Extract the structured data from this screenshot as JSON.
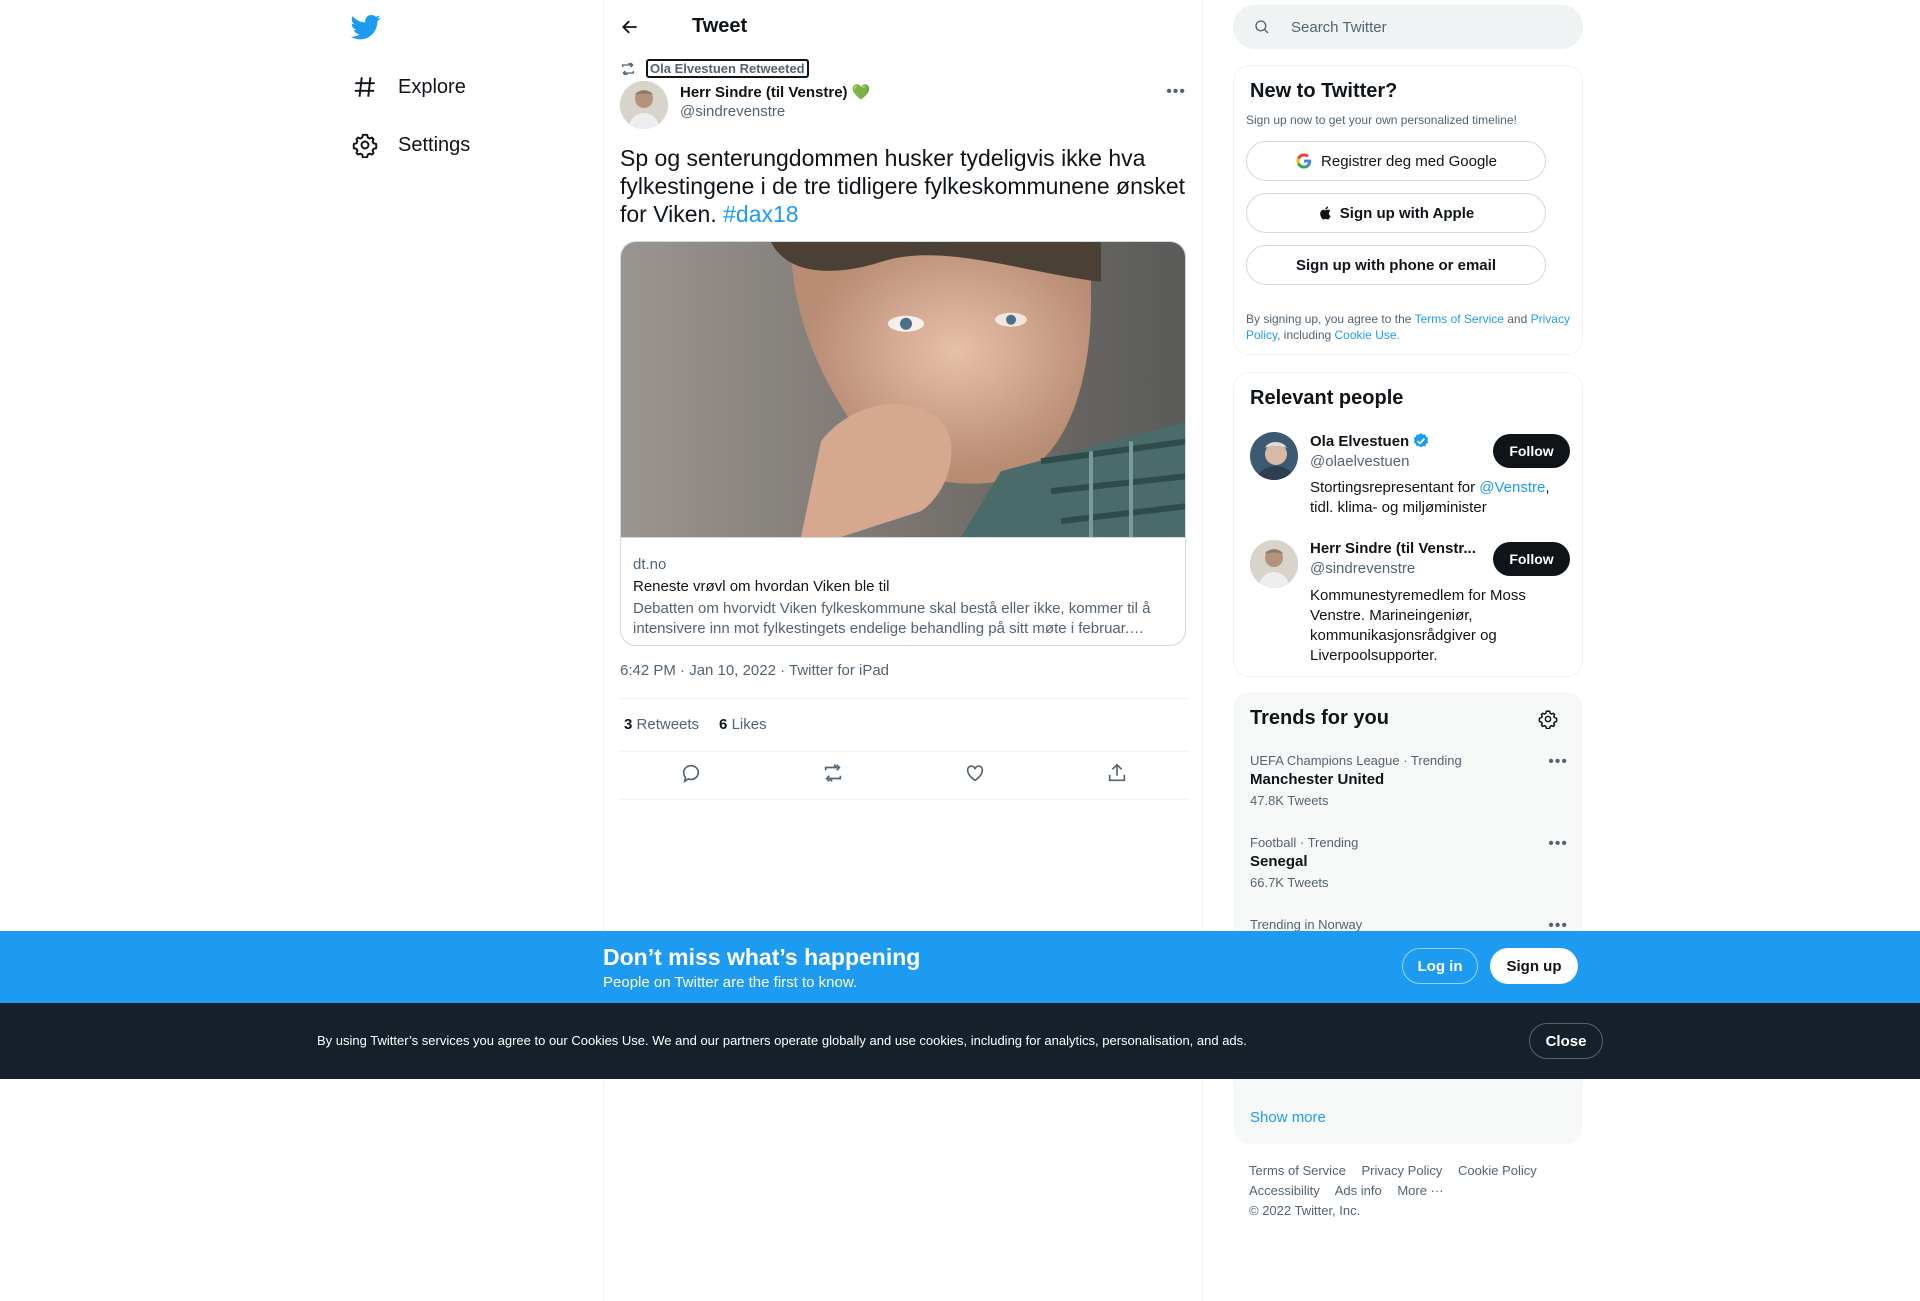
{
  "nav": {
    "explore": "Explore",
    "settings": "Settings"
  },
  "header": {
    "title": "Tweet"
  },
  "tweet": {
    "social_context": "Ola Elvestuen Retweeted",
    "author_name": "Herr Sindre (til Venstre)",
    "author_emoji": "💚",
    "author_handle": "@sindrevenstre",
    "text": "Sp og senterungdommen husker tydeligvis ikke hva fylkestingene i de tre tidligere fylkeskommunene ønsket for Viken. ",
    "hashtag": "#dax18",
    "card": {
      "domain": "dt.no",
      "title": "Reneste vrøvl om hvordan Viken ble til",
      "description": "Debatten om hvorvidt Viken fylkeskommune skal bestå eller ikke, kommer til å intensivere inn mot fylkestingets endelige behandling på sitt møte i februar. Hvordan det hele begynte har..."
    },
    "meta": "6:42 PM · Jan 10, 2022 · Twitter for iPad",
    "retweets_count": "3",
    "retweets_label": "Retweets",
    "likes_count": "6",
    "likes_label": "Likes"
  },
  "search": {
    "placeholder": "Search Twitter"
  },
  "new_to_twitter": {
    "title": "New to Twitter?",
    "subtitle": "Sign up now to get your own personalized timeline!",
    "google_label": "Registrer deg med Google",
    "apple_label": "Sign up with Apple",
    "phone_label": "Sign up with phone or email",
    "legal_prefix": "By signing up, you agree to the ",
    "tos": "Terms of Service",
    "and": " and ",
    "privacy": "Privacy Policy",
    "including": ", including ",
    "cookie": "Cookie Use."
  },
  "relevant_people": {
    "title": "Relevant people",
    "people": [
      {
        "name": "Ola Elvestuen",
        "handle": "@olaelvestuen",
        "bio_prefix": "Stortingsrepresentant for ",
        "bio_link": "@Venstre",
        "bio_suffix": ", tidl. klima- og miljøminister",
        "follow": "Follow"
      },
      {
        "name": "Herr Sindre (til Venstr...",
        "handle": "@sindrevenstre",
        "bio": "Kommunestyremedlem for Moss Venstre. Marineingeniør, kommunikasjonsrådgiver og Liverpoolsupporter.",
        "follow": "Follow"
      }
    ]
  },
  "trends": {
    "title": "Trends for you",
    "items": [
      {
        "context": "UEFA Champions League · Trending",
        "title": "Manchester United",
        "count": "47.8K Tweets"
      },
      {
        "context": "Football · Trending",
        "title": "Senegal",
        "count": "66.7K Tweets"
      },
      {
        "context": "Trending in Norway",
        "title": "",
        "count": ""
      }
    ],
    "show_more": "Show more"
  },
  "footer": {
    "tos": "Terms of Service",
    "privacy": "Privacy Policy",
    "cookie": "Cookie Policy",
    "accessibility": "Accessibility",
    "ads": "Ads info",
    "more": "More ···",
    "copyright": "© 2022 Twitter, Inc."
  },
  "bluebar": {
    "headline": "Don’t miss what’s happening",
    "sub": "People on Twitter are the first to know.",
    "login": "Log in",
    "signup": "Sign up"
  },
  "cookiebar": {
    "text": "By using Twitter’s services you agree to our Cookies Use. We and our partners operate globally and use cookies, including for analytics, personalisation, and ads.",
    "close": "Close"
  },
  "colors": {
    "accent": "#1d9bf0",
    "text": "#0f1419",
    "muted": "#536471",
    "cookie_bg": "#15202b"
  }
}
